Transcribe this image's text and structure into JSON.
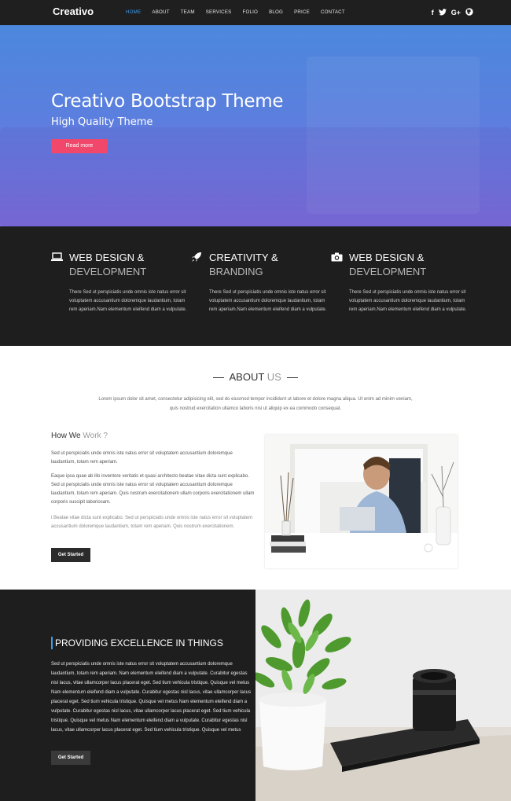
{
  "nav": {
    "brand": "Creativo",
    "items": [
      "HOME",
      "ABOUT",
      "TEAM",
      "SERVICES",
      "FOLIO",
      "BLOG",
      "PRICE",
      "CONTACT"
    ],
    "active_index": 0,
    "social": [
      "f",
      "t",
      "G+",
      "gh"
    ]
  },
  "hero": {
    "title": "Creativo Bootstrap Theme",
    "subtitle": "High Quality Theme",
    "button": "Read more"
  },
  "features": [
    {
      "icon": "laptop-icon",
      "line1": "WEB DESIGN &",
      "line2": "DEVELOPMENT",
      "desc": "There Sed ut perspiciatis unde omnis iste natus error sit voluptatem accusantium doloremque laudantium, totam rem aperiam.Nam elementum eleifend diam a vulputate."
    },
    {
      "icon": "rocket-icon",
      "line1": "CREATIVITY &",
      "line2": "BRANDING",
      "desc": "There Sed ut perspiciatis unde omnis iste natus error sit voluptatem accusantium doloremque laudantium, totam rem aperiam.Nam elementum eleifend diam a vulputate."
    },
    {
      "icon": "camera-icon",
      "line1": "WEB DESIGN &",
      "line2": "DEVELOPMENT",
      "desc": "There Sed ut perspiciatis unde omnis iste natus error sit voluptatem accusantium doloremque laudantium, totam rem aperiam.Nam elementum eleifend diam a vulputate."
    }
  ],
  "about": {
    "title_a": "ABOUT",
    "title_b": "US",
    "intro": "Lorem ipsum dolor sit amet, consectetur adipisicing elit, sed do eiusmod tempor incididunt ut labore et dolore magna aliqua. Ut enim ad minim veniam, quis nostrud exercitation ullamco laboris nisi ut aliquip ex ea commodo consequat.",
    "how_a": "How We",
    "how_b": "Work ?",
    "p1": "Sed ut perspiciatis unde omnis iste natus error sit voluptatem accusantium doloremque laudantium, totam rem aperiam.",
    "p2": "Eaque ipsa quae ab illo inventore veritatis et quasi architecto beatae vitae dicta sunt explicabo. Sed ut perspiciatis unde omnis iste natus error sit voluptatem accusantium doloremque laudantium, totam rem aperiam. Quis nostrum exercitationem ullam corporis exercitationem ullam corporis suscipit laboriosam.",
    "p3": "i Beatae vitae dicta sunt explicabo. Sed ut perspiciatis unde omnis iste natus error sit voluptatem accusantium doloremque laudantium, totam rem aperiam. Quis nostrum exercitationem.",
    "button": "Get Started"
  },
  "excellence": {
    "title": "PROVIDING EXCELLENCE IN THINGS",
    "text": "Sed ut perspiciatis unde omnis iste natus error sit voluptatem accusantium doloremque laudantium, totam rem aperiam. Nam elementum eleifend diam a vulputate. Curabitur egestas nisl lacus, vitae ullamcorper lacus placerat eget. Sed tium vehicula tristique. Quisque vel metus Nam elementum eleifend diam a vulputate. Curabitur egestas nisl lacus, vitae ullamcorper lacus placerat eget. Sed tium vehicula tristique. Quisque vel metus Nam elementum eleifend diam a vulputate. Curabitur egestas nisl lacus, vitae ullamcorper lacus placerat eget. Sed tium vehicula tristique. Quisque vel metus Nam elementum eleifend diam a vulputate. Curabitur egestas nisl lacus, vitae ullamcorper lacus placerat eget. Sed tium vehicula tristique. Quisque vel metus",
    "button": "Get Started"
  },
  "colors": {
    "accent": "#3d9be9",
    "cta": "#f0476a",
    "dark": "#1e1e1f"
  }
}
